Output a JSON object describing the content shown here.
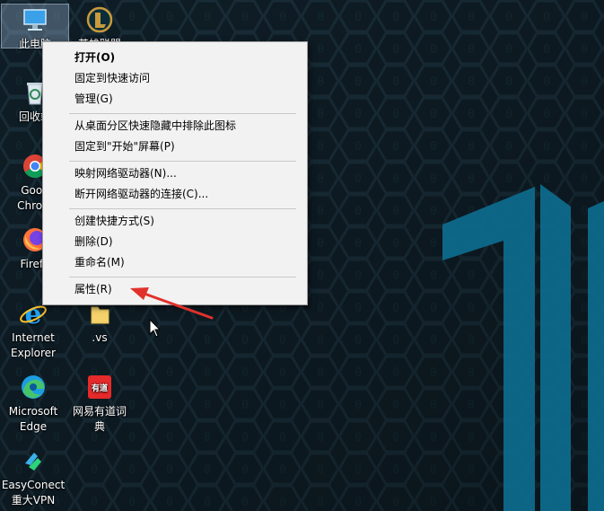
{
  "desktop": {
    "icons": [
      {
        "label": "此电脑",
        "icon": "this-pc-icon",
        "selected": true
      },
      {
        "label": "英雄联盟",
        "icon": "league-of-legends-icon"
      },
      {
        "label": "回收站",
        "icon": "recycle-bin-icon"
      },
      {
        "label": "Google Chrome",
        "icon": "chrome-icon"
      },
      {
        "label": "Firefox",
        "icon": "firefox-icon"
      },
      {
        "label": "Internet Explorer",
        "icon": "internet-explorer-icon"
      },
      {
        "label": ".vs",
        "icon": "folder-icon"
      },
      {
        "label": "Microsoft Edge",
        "icon": "edge-icon"
      },
      {
        "label": "网易有道词典",
        "icon": "youdao-dictionary-icon"
      },
      {
        "label": "EasyConect 重大VPN",
        "icon": "easyconnect-icon"
      }
    ],
    "visible_labels": {
      "this_pc": "此电脑",
      "lol": "英雄联盟",
      "recycle": "回收站",
      "chrome_1": "Goog",
      "chrome_2": "Chrom",
      "firefox": "Firefo",
      "ie_1": "Internet",
      "ie_2": "Explorer",
      "vs": ".vs",
      "edge_1": "Microsoft",
      "edge_2": "Edge",
      "youdao_1": "网易有道词",
      "youdao_2": "典",
      "youdao_badge": "有道",
      "vpn_1": "EasyConect",
      "vpn_2": "重大VPN"
    },
    "accent_color": "#0e6a8c"
  },
  "context_menu": {
    "items": [
      {
        "label": "打开(O)",
        "bold": true
      },
      {
        "label": "固定到快速访问"
      },
      {
        "label": "管理(G)"
      },
      {
        "label": "从桌面分区快速隐藏中排除此图标"
      },
      {
        "label": "固定到\"开始\"屏幕(P)"
      },
      {
        "label": "映射网络驱动器(N)..."
      },
      {
        "label": "断开网络驱动器的连接(C)..."
      },
      {
        "label": "创建快捷方式(S)"
      },
      {
        "label": "删除(D)"
      },
      {
        "label": "重命名(M)"
      },
      {
        "label": "属性(R)",
        "highlighted_by_annotation": true
      }
    ]
  },
  "annotation": {
    "type": "red-arrow",
    "points_to": "属性(R)",
    "color": "#e0322b"
  }
}
